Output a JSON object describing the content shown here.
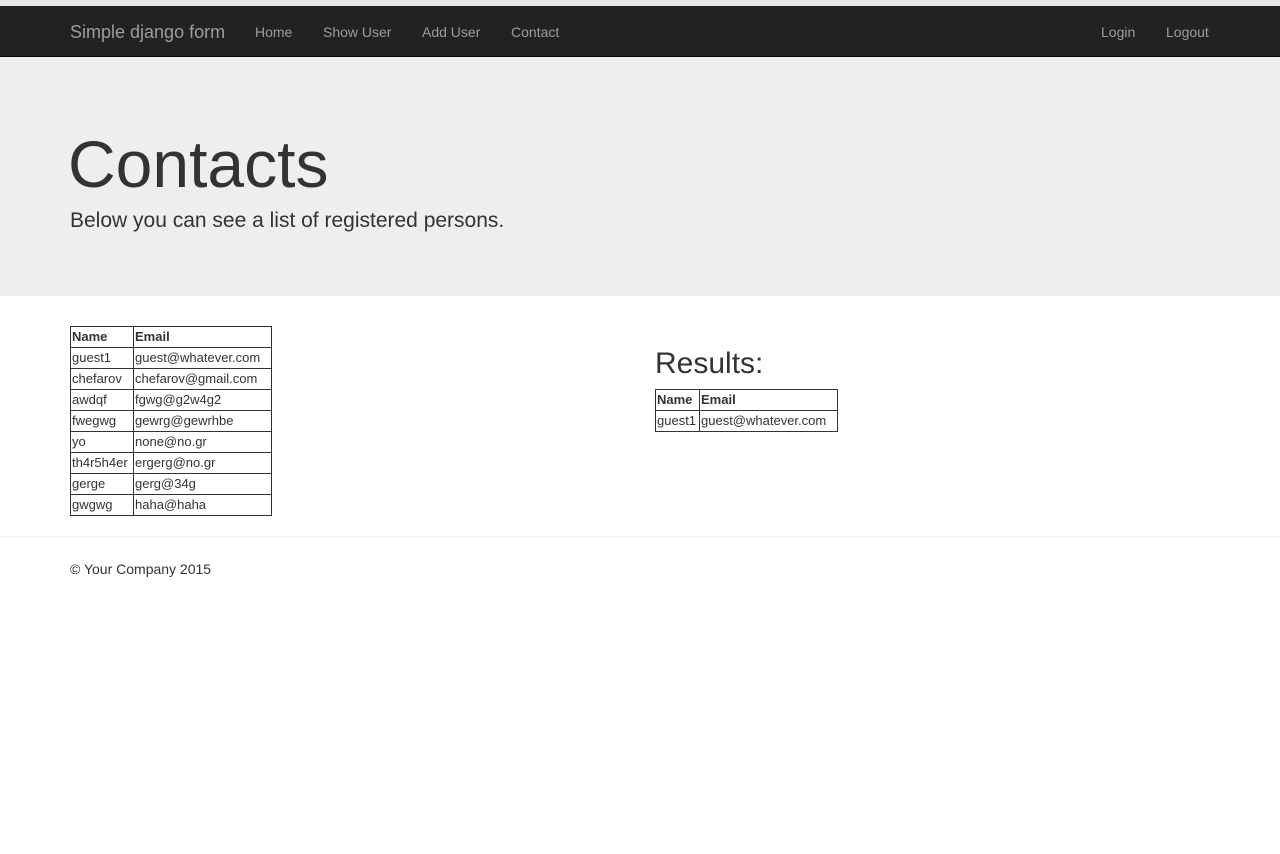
{
  "navbar": {
    "brand": "Simple django form",
    "links": [
      "Home",
      "Show User",
      "Add User",
      "Contact"
    ],
    "right_links": [
      "Login",
      "Logout"
    ]
  },
  "jumbotron": {
    "title": "Contacts",
    "subtitle": "Below you can see a list of registered persons."
  },
  "contacts": {
    "headers": [
      "Name",
      "Email"
    ],
    "rows": [
      [
        "guest1",
        "guest@whatever.com"
      ],
      [
        "chefarov",
        "chefarov@gmail.com"
      ],
      [
        "awdqf",
        "fgwg@g2w4g2"
      ],
      [
        "fwegwg",
        "gewrg@gewrhbe"
      ],
      [
        "yo",
        "none@no.gr"
      ],
      [
        "th4r5h4er",
        "ergerg@no.gr"
      ],
      [
        "gerge",
        "gerg@34g"
      ],
      [
        "gwgwg",
        "haha@haha"
      ]
    ]
  },
  "results": {
    "heading": "Results:",
    "headers": [
      "Name",
      "Email"
    ],
    "rows": [
      [
        "guest1",
        "guest@whatever.com"
      ]
    ]
  },
  "footer": {
    "text": "© Your Company 2015"
  }
}
